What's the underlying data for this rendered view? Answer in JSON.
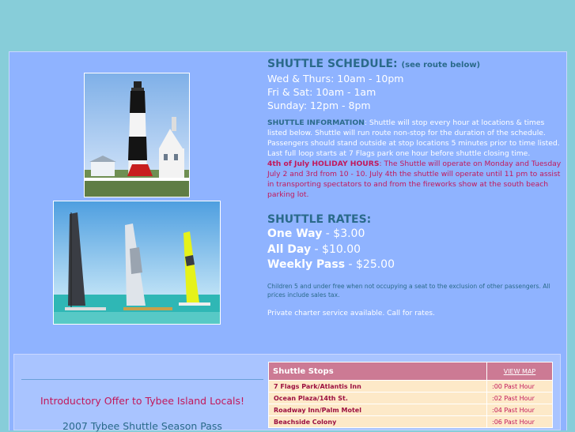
{
  "schedule": {
    "heading": "SHUTTLE SCHEDULE:",
    "see_route": "(see route below)",
    "hours": [
      "Wed & Thurs: 10am - 10pm",
      "Fri & Sat: 10am - 1am",
      "Sunday: 12pm - 8pm"
    ]
  },
  "info": {
    "label": "SHUTTLE INFORMATION",
    "text": ": Shuttle will stop every hour at locations & times listed below. Shuttle will run route non-stop for the duration of the schedule. Passengers should stand outside at stop locations 5 minutes prior to time listed. Last full loop starts at 7 Flags park one hour before shuttle closing time.",
    "july_label": "4th of July HOLIDAY HOURS",
    "july_text": ": The Shuttle will operate on Monday and Tuesday July 2 and 3rd from 10 - 10.  July 4th the shuttle will operate until 11 pm to assist in transporting spectators to and from the fireworks show at the south beach parking lot."
  },
  "rates": {
    "heading": "SHUTTLE RATES:",
    "items": [
      {
        "label": "One Way",
        "price": " - $3.00"
      },
      {
        "label": "All Day",
        "price": " - $10.00"
      },
      {
        "label": "Weekly Pass",
        "price": " - $25.00"
      }
    ],
    "note": "Children 5 and under free when not occupying a seat to the exclusion of other passengers. All prices include sales tax.",
    "charter": "Private charter service available.   Call for rates."
  },
  "promo": {
    "offer": "Introductory Offer to Tybee Island Locals!",
    "pass": "2007 Tybee Shuttle Season Pass"
  },
  "stops": {
    "title": "Shuttle Stops",
    "view_map": "VIEW MAP",
    "rows": [
      {
        "name": "7 Flags Park/Atlantis Inn",
        "time": ":00 Past Hour"
      },
      {
        "name": "Ocean Plaza/14th St.",
        "time": ":02 Past Hour"
      },
      {
        "name": "Roadway Inn/Palm Motel",
        "time": ":04 Past Hour"
      },
      {
        "name": "Beachside Colony",
        "time": ":06 Past Hour"
      }
    ]
  },
  "colors": {
    "background": "#87cdd9",
    "panel": "#8fb3ff",
    "heading": "#2a6a8a",
    "accent": "#c2185b",
    "table_header": "#cc7a94",
    "table_row": "#fde9c8"
  }
}
